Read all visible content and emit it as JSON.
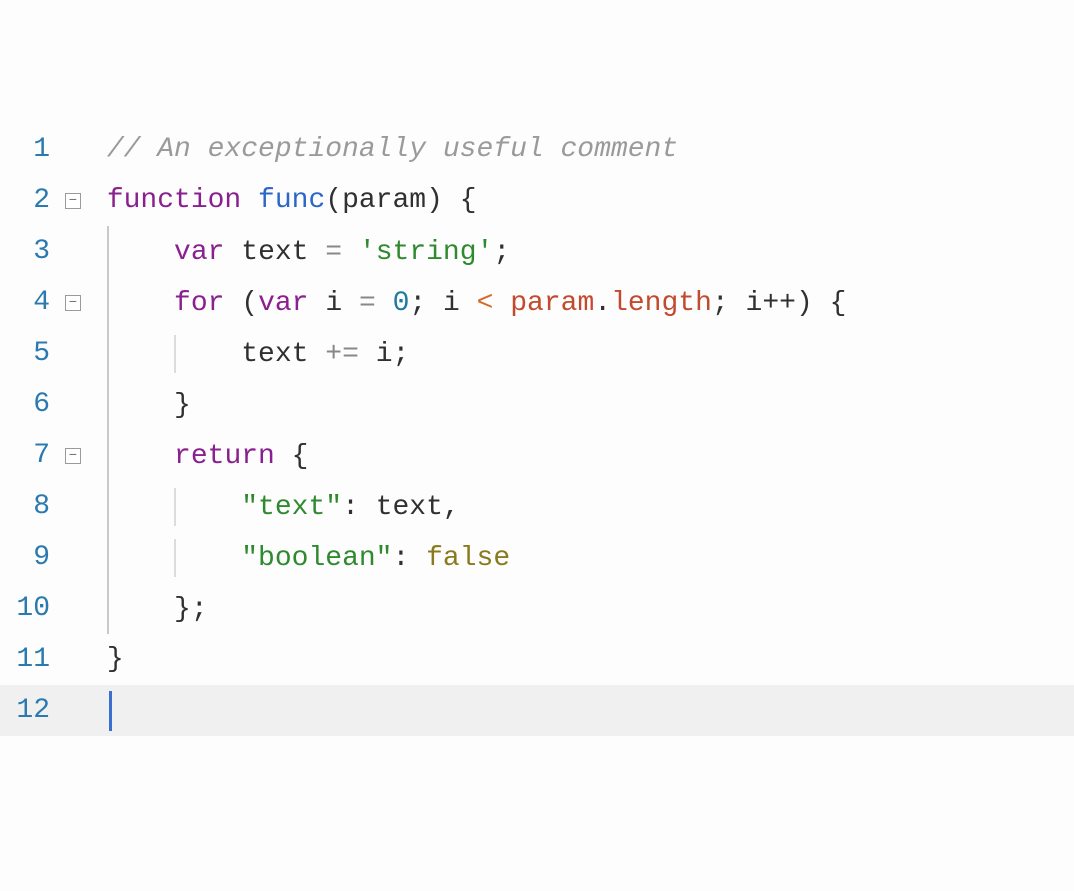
{
  "lineNumbers": [
    "1",
    "2",
    "3",
    "4",
    "5",
    "6",
    "7",
    "8",
    "9",
    "10",
    "11",
    "12"
  ],
  "fold": {
    "minus": "−"
  },
  "tokens": {
    "comment": "// An exceptionally useful comment",
    "function": "function",
    "func": "func",
    "paren_open": "(",
    "param_decl": "param",
    "paren_close": ")",
    "brace_open": "{",
    "brace_close": "}",
    "var": "var",
    "text_id": "text",
    "eq": "=",
    "string_lit": "'string'",
    "semi": ";",
    "for": "for",
    "i_id": "i",
    "zero": "0",
    "lt": "<",
    "param_ref": "param",
    "dot": ".",
    "length": "length",
    "ipp": "i++",
    "pluseq": "+=",
    "return": "return",
    "key_text": "\"text\"",
    "colon": ":",
    "comma": ",",
    "key_boolean": "\"boolean\"",
    "false": "false"
  }
}
